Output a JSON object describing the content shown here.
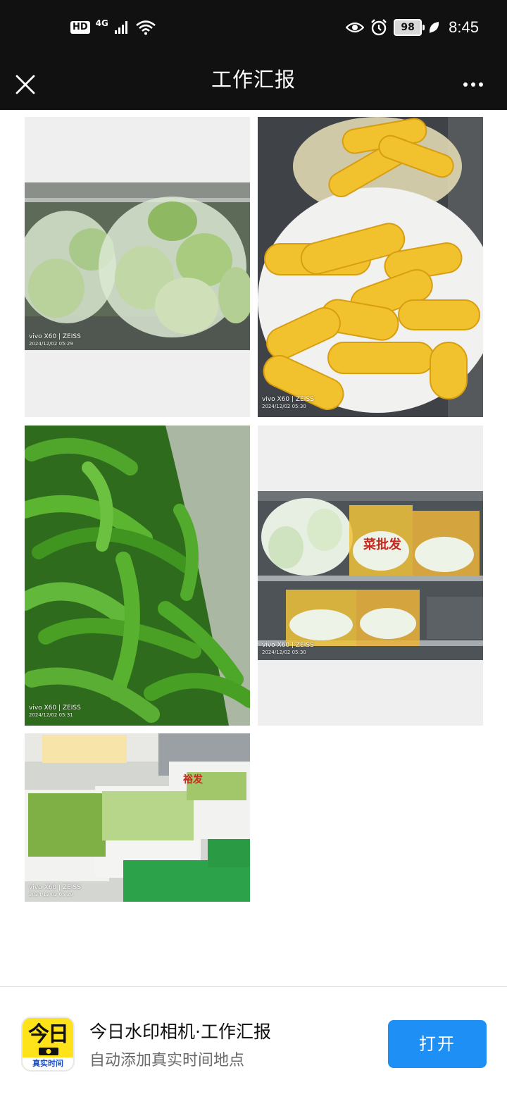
{
  "status_bar": {
    "hd_label": "HD",
    "network_label": "4G",
    "battery_level": "98",
    "time": "8:45",
    "icons": [
      "signal-icon",
      "wifi-icon",
      "eye-icon",
      "alarm-icon",
      "battery-icon",
      "leaf-icon"
    ]
  },
  "header": {
    "title": "工作汇报",
    "close_icon": "close-icon",
    "more_icon": "more-icon"
  },
  "photos": [
    {
      "subject": "cabbage",
      "watermark_brand": "vivo X60 | ZEISS",
      "watermark_date": "2024/12/02 05:29"
    },
    {
      "subject": "corn",
      "watermark_brand": "vivo X60 | ZEISS",
      "watermark_date": "2024/12/02 05:30"
    },
    {
      "subject": "green-peppers",
      "watermark_brand": "vivo X60 | ZEISS",
      "watermark_date": "2024/12/02 05:31"
    },
    {
      "subject": "napa-cabbage",
      "watermark_brand": "vivo X60 | ZEISS",
      "watermark_date": "2024/12/02 05:30",
      "crate_text": "菜批发"
    },
    {
      "subject": "vegetable-crates",
      "watermark_brand": "vivo X60 | ZEISS",
      "watermark_date": "2024/12/02 05:29",
      "crate_text": "裕发"
    }
  ],
  "banner": {
    "app_icon_text": "今日",
    "app_icon_caption": "真实时间",
    "app_title": "今日水印相机·工作汇报",
    "app_subtitle": "自动添加真实时间地点",
    "open_button": "打开"
  },
  "colors": {
    "header_bg": "#111111",
    "open_button_bg": "#1e90f5",
    "app_icon_bg": "#ffe31a"
  }
}
